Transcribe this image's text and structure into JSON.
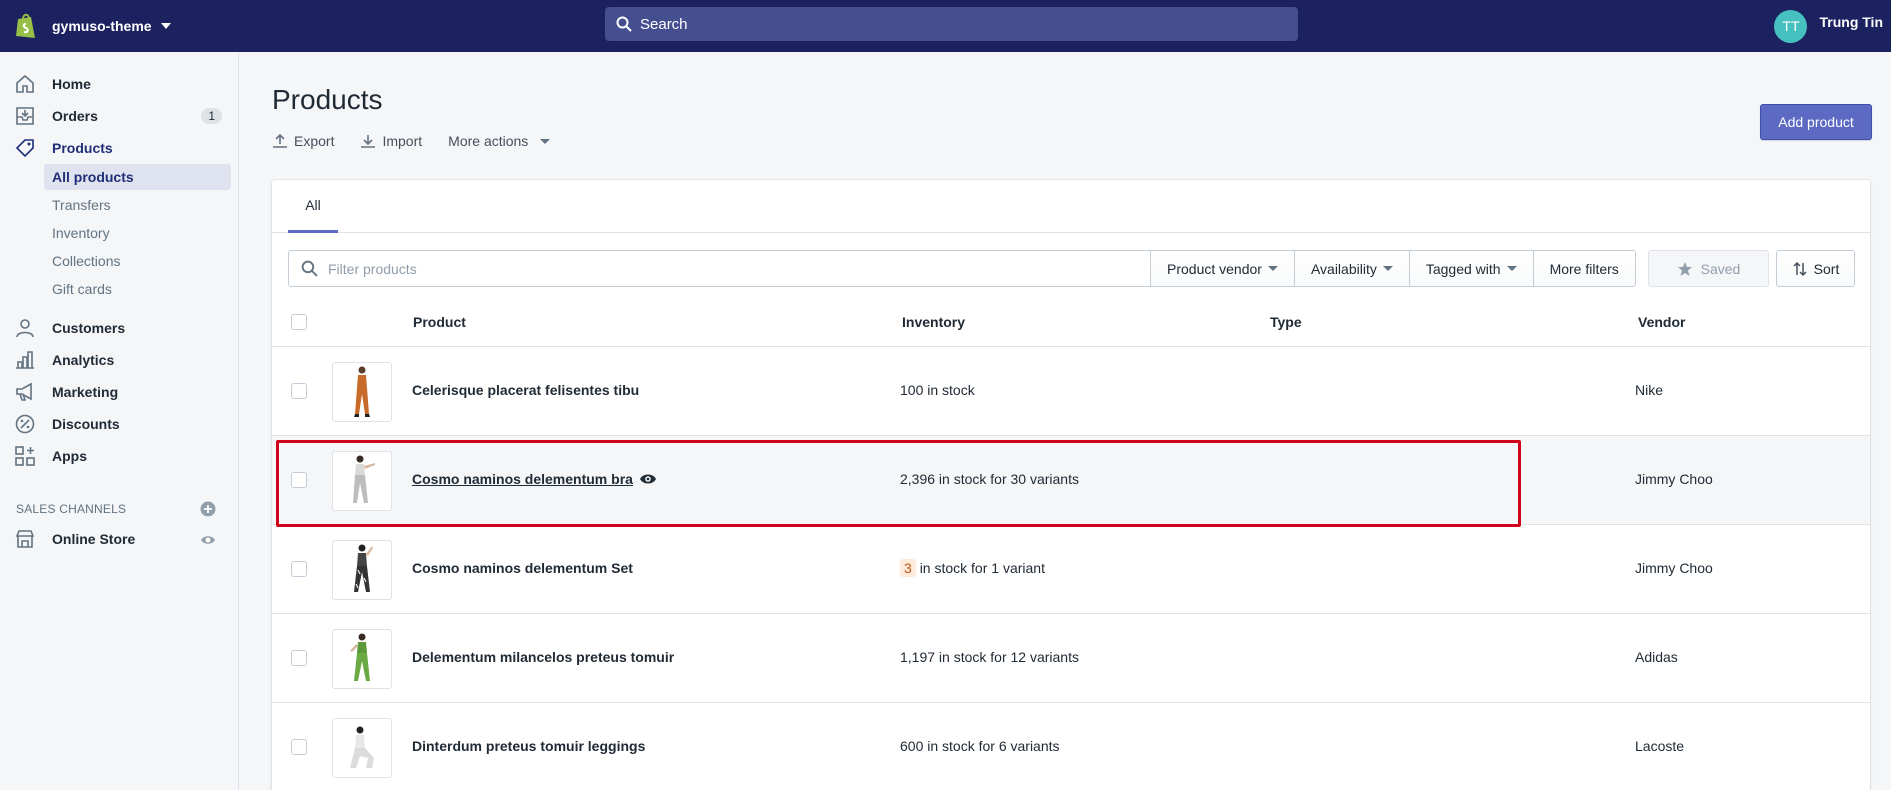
{
  "topbar": {
    "store_name": "gymuso-theme",
    "search_placeholder": "Search",
    "user_initials": "TT",
    "user_name": "Trung Tin"
  },
  "sidebar": {
    "items": [
      {
        "label": "Home",
        "icon": "home-icon"
      },
      {
        "label": "Orders",
        "icon": "orders-icon",
        "badge": "1"
      },
      {
        "label": "Products",
        "icon": "tag-icon"
      },
      {
        "label": "Customers",
        "icon": "person-icon"
      },
      {
        "label": "Analytics",
        "icon": "bar-chart-icon"
      },
      {
        "label": "Marketing",
        "icon": "megaphone-icon"
      },
      {
        "label": "Discounts",
        "icon": "discount-icon"
      },
      {
        "label": "Apps",
        "icon": "apps-icon"
      }
    ],
    "subitems": [
      "All products",
      "Transfers",
      "Inventory",
      "Collections",
      "Gift cards"
    ],
    "sales_channels_title": "SALES CHANNELS",
    "online_store": "Online Store"
  },
  "page": {
    "title": "Products",
    "export": "Export",
    "import": "Import",
    "more_actions": "More actions",
    "add_product": "Add product"
  },
  "tabs": [
    "All"
  ],
  "filters": {
    "placeholder": "Filter products",
    "product_vendor": "Product vendor",
    "availability": "Availability",
    "tagged_with": "Tagged with",
    "more_filters": "More filters",
    "saved": "Saved",
    "sort": "Sort"
  },
  "table": {
    "headers": [
      "Product",
      "Inventory",
      "Type",
      "Vendor"
    ],
    "rows": [
      {
        "name": "Celerisque placerat felisentes tibu",
        "inventory": "100 in stock",
        "type": "",
        "vendor": "Nike"
      },
      {
        "name": "Cosmo naminos delementum bra",
        "inventory": "2,396 in stock for 30 variants",
        "type": "",
        "vendor": "Jimmy Choo"
      },
      {
        "name": "Cosmo naminos delementum Set",
        "inventory_low": "3",
        "inventory": "in stock for 1 variant",
        "type": "",
        "vendor": "Jimmy Choo"
      },
      {
        "name": "Delementum milancelos preteus tomuir",
        "inventory": "1,197 in stock for 12 variants",
        "type": "",
        "vendor": "Adidas"
      },
      {
        "name": "Dinterdum preteus tomuir leggings",
        "inventory": "600 in stock for 6 variants",
        "type": "",
        "vendor": "Lacoste"
      }
    ]
  },
  "colors": {
    "topbar": "#1c2260",
    "accent": "#5c6ac4",
    "highlight": "#d0021b"
  }
}
